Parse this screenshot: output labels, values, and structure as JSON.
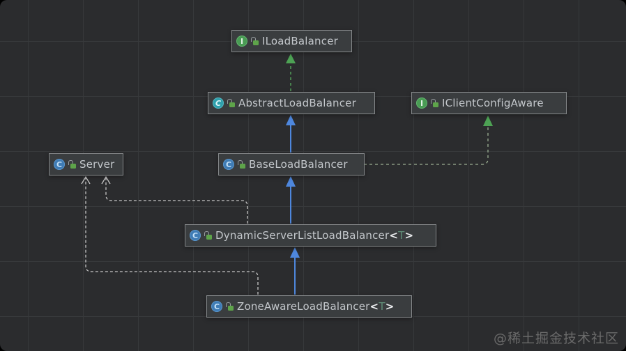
{
  "diagram": {
    "kind": "uml-class-diagram",
    "nodes": [
      {
        "id": "iloadbalancer",
        "label": "ILoadBalancer",
        "generic": null,
        "type": "interface",
        "modifier_icon": "open-lock-icon"
      },
      {
        "id": "abstractloadbalancer",
        "label": "AbstractLoadBalancer",
        "generic": null,
        "type": "abstract-class",
        "modifier_icon": "open-lock-icon"
      },
      {
        "id": "iclientconfigaware",
        "label": "IClientConfigAware",
        "generic": null,
        "type": "interface",
        "modifier_icon": "open-lock-icon"
      },
      {
        "id": "server",
        "label": "Server",
        "generic": null,
        "type": "class",
        "modifier_icon": "open-lock-icon"
      },
      {
        "id": "baseloadbalancer",
        "label": "BaseLoadBalancer",
        "generic": null,
        "type": "class",
        "modifier_icon": "open-lock-icon"
      },
      {
        "id": "dynamicserverlistloadbalancer",
        "label": "DynamicServerListLoadBalancer",
        "generic": "T",
        "type": "class",
        "modifier_icon": "open-lock-icon"
      },
      {
        "id": "zoneawareloadbalancer",
        "label": "ZoneAwareLoadBalancer",
        "generic": "T",
        "type": "class",
        "modifier_icon": "open-lock-icon"
      }
    ],
    "edges": [
      {
        "from": "AbstractLoadBalancer",
        "to": "ILoadBalancer",
        "type": "implements"
      },
      {
        "from": "BaseLoadBalancer",
        "to": "AbstractLoadBalancer",
        "type": "extends"
      },
      {
        "from": "BaseLoadBalancer",
        "to": "IClientConfigAware",
        "type": "implements"
      },
      {
        "from": "DynamicServerListLoadBalancer",
        "to": "BaseLoadBalancer",
        "type": "extends"
      },
      {
        "from": "ZoneAwareLoadBalancer",
        "to": "DynamicServerListLoadBalancer",
        "type": "extends"
      },
      {
        "from": "DynamicServerListLoadBalancer",
        "to": "Server",
        "type": "dependency"
      },
      {
        "from": "ZoneAwareLoadBalancer",
        "to": "Server",
        "type": "dependency"
      }
    ],
    "icon_letters": {
      "interface": "I",
      "class": "C",
      "abstract-class": "C"
    }
  },
  "colors": {
    "canvas_background": "#2b2c2e",
    "grid_line": "#37393b",
    "node_background": "#3a3d3f",
    "node_border": "#85888a",
    "node_text": "#c3c7cb",
    "generic_bracket": "#eceef0",
    "generic_param": "#5f8d77",
    "extends_line": "#4e87dd",
    "implements_line": "#4f9757",
    "implements_line_pale": "#9cb093",
    "implements_head": "#4da254",
    "dependency_line": "#c6c6c6",
    "interface_icon": "#499c54",
    "class_icon": "#3f7cb5",
    "abstract_class_icon": "#2fa0ac",
    "lock_icon": "#5ea44a"
  },
  "watermark": {
    "text": "@稀土掘金技术社区"
  }
}
